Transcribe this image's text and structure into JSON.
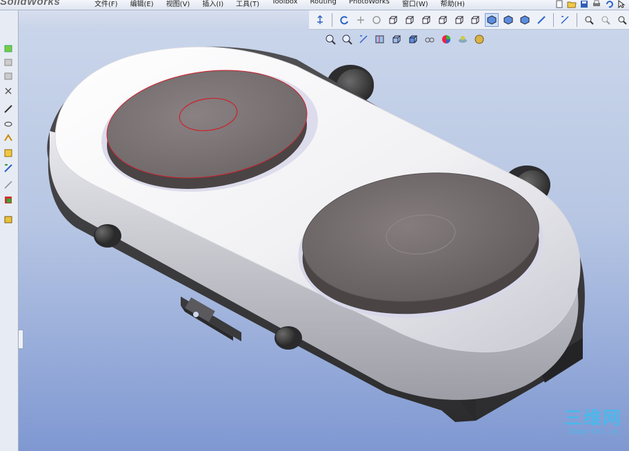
{
  "app": {
    "brand": "SolidWorks"
  },
  "menu": {
    "items": [
      "文件(F)",
      "编辑(E)",
      "视图(V)",
      "插入(I)",
      "工具(T)",
      "Toolbox",
      "Routing",
      "PhotoWorks",
      "窗口(W)",
      "帮助(H)"
    ]
  },
  "toolbar": {
    "standard_icons": [
      "normal-to-icon",
      "rotate-icon",
      "pan-icon",
      "roll-icon",
      "front-view-icon",
      "back-view-icon",
      "left-view-icon",
      "right-view-icon",
      "top-view-icon",
      "bottom-view-icon",
      "isometric-view-icon",
      "trimetric-view-icon",
      "dimetric-view-icon",
      "sketch-icon",
      "smart-dimension-icon",
      "zoom-fit-icon",
      "zoom-area-icon",
      "select-icon"
    ],
    "active_icon": "isometric-view-icon"
  },
  "view_toolbar": {
    "icons": [
      "zoom-to-fit-icon",
      "zoom-to-area-icon",
      "previous-view-icon",
      "section-view-icon",
      "view-orientation-icon",
      "display-style-icon",
      "hide-show-items-icon",
      "edit-appearance-icon",
      "apply-scene-icon",
      "view-settings-icon"
    ]
  },
  "left_panel": {
    "icons": [
      "feature-tree-icon",
      "property-manager-icon",
      "configuration-icon",
      "dimxpert-icon",
      "display-manager-icon",
      "sketch-tool-icon",
      "mate-icon",
      "appearance-icon",
      "design-library-icon",
      "file-explorer-icon",
      "view-palette-icon"
    ]
  },
  "watermark": {
    "main": "三维网",
    "sub": "3dportal.cn"
  },
  "colors": {
    "viewport_top": "#c9d5ea",
    "viewport_bottom": "#7f98d2",
    "body_white": "#f6f6f8",
    "plate_gray": "#7a7273",
    "base_dark": "#3a3a3c",
    "edge_red": "#d0202a",
    "watermark": "#4db7ea"
  }
}
